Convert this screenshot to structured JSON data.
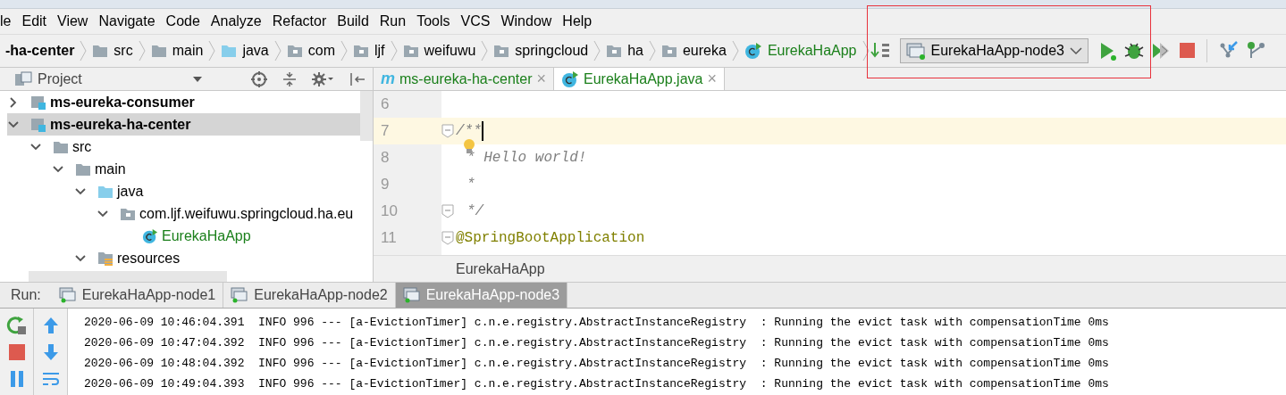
{
  "menu": [
    "le",
    "Edit",
    "View",
    "Navigate",
    "Code",
    "Analyze",
    "Refactor",
    "Build",
    "Run",
    "Tools",
    "VCS",
    "Window",
    "Help"
  ],
  "breadcrumbs": [
    {
      "label": "-ha-center",
      "kind": "module"
    },
    {
      "label": "src",
      "kind": "folder"
    },
    {
      "label": "main",
      "kind": "folder"
    },
    {
      "label": "java",
      "kind": "source"
    },
    {
      "label": "com",
      "kind": "package"
    },
    {
      "label": "ljf",
      "kind": "package"
    },
    {
      "label": "weifuwu",
      "kind": "package"
    },
    {
      "label": "springcloud",
      "kind": "package"
    },
    {
      "label": "ha",
      "kind": "package"
    },
    {
      "label": "eureka",
      "kind": "package"
    },
    {
      "label": "EurekaHaApp",
      "kind": "class"
    }
  ],
  "run_config": {
    "label": "EurekaHaApp-node3"
  },
  "project_panel": {
    "title": "Project",
    "tree": [
      {
        "label": "ms-eureka-consumer",
        "kind": "module",
        "expanded": false,
        "selected": false
      },
      {
        "label": "ms-eureka-ha-center",
        "kind": "module",
        "expanded": true,
        "selected": true,
        "children": [
          {
            "label": "src",
            "kind": "folder",
            "expanded": true,
            "selected": false,
            "children": [
              {
                "label": "main",
                "kind": "folder",
                "expanded": true,
                "selected": false,
                "children": [
                  {
                    "label": "java",
                    "kind": "source",
                    "expanded": true,
                    "selected": false,
                    "children": [
                      {
                        "label": "com.ljf.weifuwu.springcloud.ha.eu",
                        "kind": "package",
                        "expanded": true,
                        "selected": false,
                        "children": [
                          {
                            "label": "EurekaHaApp",
                            "kind": "class",
                            "selected": false
                          }
                        ]
                      }
                    ]
                  },
                  {
                    "label": "resources",
                    "kind": "resources",
                    "expanded": true,
                    "selected": false
                  }
                ]
              }
            ]
          }
        ]
      }
    ]
  },
  "editor": {
    "tabs": [
      {
        "label": "ms-eureka-ha-center",
        "kind": "maven",
        "icon_text": "m",
        "close": "×",
        "selected": false
      },
      {
        "label": "EurekaHaApp.java",
        "kind": "class",
        "close": "×",
        "selected": true
      }
    ],
    "lines": [
      {
        "number": "6",
        "current": false
      },
      {
        "number": "7",
        "text": "/**",
        "kind": "comment",
        "current": true,
        "fold": true
      },
      {
        "number": "8",
        "text": "* Hello world!",
        "kind": "comment",
        "current": false,
        "bulb": true
      },
      {
        "number": "9",
        "text": "*",
        "kind": "comment",
        "current": false
      },
      {
        "number": "10",
        "text": "*/",
        "kind": "comment",
        "current": false,
        "fold": true
      },
      {
        "number": "11",
        "text": "@SpringBootApplication",
        "kind": "annotation",
        "current": false,
        "fold": true
      }
    ],
    "breadcrumb": "EurekaHaApp"
  },
  "run_panel": {
    "label": "Run:",
    "tabs": [
      {
        "label": "EurekaHaApp-node1",
        "selected": false
      },
      {
        "label": "EurekaHaApp-node2",
        "selected": false
      },
      {
        "label": "EurekaHaApp-node3",
        "selected": true
      }
    ],
    "console": [
      "2020-06-09 10:46:04.391  INFO 996 --- [a-EvictionTimer] c.n.e.registry.AbstractInstanceRegistry  : Running the evict task with compensationTime 0ms",
      "2020-06-09 10:47:04.392  INFO 996 --- [a-EvictionTimer] c.n.e.registry.AbstractInstanceRegistry  : Running the evict task with compensationTime 0ms",
      "2020-06-09 10:48:04.392  INFO 996 --- [a-EvictionTimer] c.n.e.registry.AbstractInstanceRegistry  : Running the evict task with compensationTime 0ms",
      "2020-06-09 10:49:04.393  INFO 996 --- [a-EvictionTimer] c.n.e.registry.AbstractInstanceRegistry  : Running the evict task with compensationTime 0ms"
    ]
  }
}
